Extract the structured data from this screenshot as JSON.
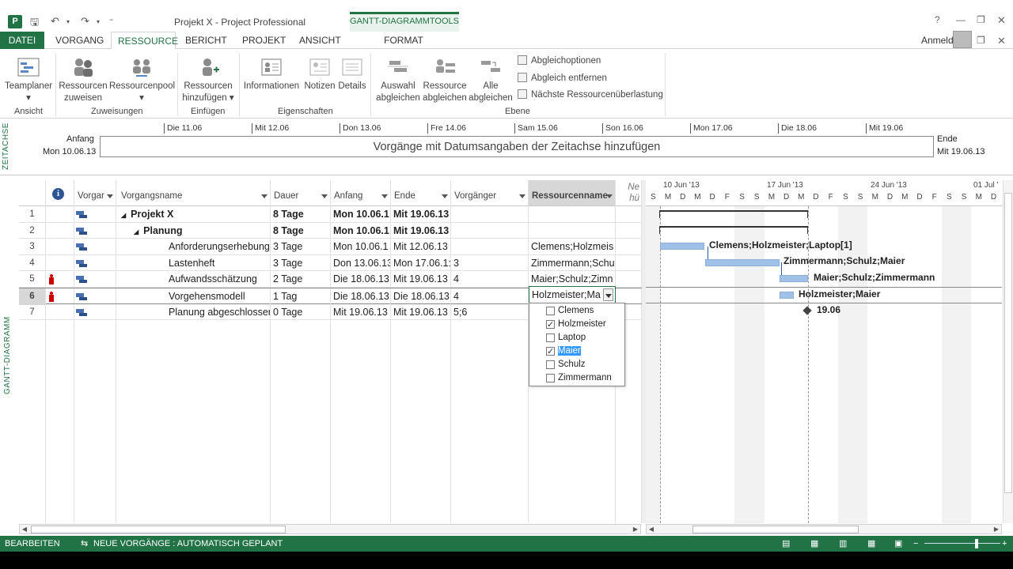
{
  "window": {
    "title": "Projekt X - Project Professional",
    "context_tab": "GANTT-DIAGRAMMTOOLS",
    "help": "?"
  },
  "tabs": [
    {
      "label": "DATEI"
    },
    {
      "label": "VORGANG"
    },
    {
      "label": "RESSOURCE"
    },
    {
      "label": "BERICHT"
    },
    {
      "label": "PROJEKT"
    },
    {
      "label": "ANSICHT"
    },
    {
      "label": "FORMAT"
    }
  ],
  "account": {
    "signin": "Anmelden"
  },
  "ribbon": {
    "buttons": {
      "teamplaner": [
        "Teamplaner",
        "▾"
      ],
      "ressourcen_zuweisen": [
        "Ressourcen",
        "zuweisen"
      ],
      "ressourcenpool": [
        "Ressourcenpool",
        "▾"
      ],
      "ressourcen_hinzufuegen": [
        "Ressourcen",
        "hinzufügen ▾"
      ],
      "informationen": "Informationen",
      "notizen": "Notizen",
      "details": "Details",
      "auswahl_abgleichen": [
        "Auswahl",
        "abgleichen"
      ],
      "ressource_abgleichen": [
        "Ressource",
        "abgleichen"
      ],
      "alle_abgleichen": [
        "Alle",
        "abgleichen"
      ],
      "abgleichoptionen": "Abgleichoptionen",
      "abgleich_entfernen": "Abgleich entfernen",
      "naechste_ueberlastung": "Nächste Ressourcenüberlastung"
    },
    "groups": {
      "ansicht": "Ansicht",
      "zuweisungen": "Zuweisungen",
      "einfuegen": "Einfügen",
      "eigenschaften": "Eigenschaften",
      "ebene": "Ebene"
    }
  },
  "timeline": {
    "side_label": "ZEITACHSE",
    "start_label": "Anfang",
    "start_date": "Mon 10.06.13",
    "end_label": "Ende",
    "end_date": "Mit 19.06.13",
    "placeholder": "Vorgänge mit Datumsangaben der Zeitachse hinzufügen",
    "days": [
      "Die 11.06",
      "Mit 12.06",
      "Don 13.06",
      "Fre 14.06",
      "Sam 15.06",
      "Son 16.06",
      "Mon 17.06",
      "Die 18.06",
      "Mit 19.06"
    ]
  },
  "view_label": "GANTT-DIAGRAMM",
  "grid": {
    "columns": {
      "info": "i",
      "mode": "Vorgar",
      "name": "Vorgangsname",
      "dauer": "Dauer",
      "anfang": "Anfang",
      "ende": "Ende",
      "vorgaenger": "Vorgänger",
      "ressourcen": "Ressourcenname",
      "neue_spalte": [
        "Ne",
        "hü"
      ]
    },
    "rows": [
      {
        "id": "1",
        "name": "Projekt X",
        "dauer": "8 Tage",
        "anfang": "Mon 10.06.1",
        "ende": "Mit 19.06.13",
        "vorgaenger": "",
        "ressourcen": "",
        "bold": true,
        "level": 0,
        "collapse": "◢",
        "person": false
      },
      {
        "id": "2",
        "name": "Planung",
        "dauer": "8 Tage",
        "anfang": "Mon 10.06.1",
        "ende": "Mit 19.06.13",
        "vorgaenger": "",
        "ressourcen": "",
        "bold": true,
        "level": 1,
        "collapse": "◢",
        "person": false
      },
      {
        "id": "3",
        "name": "Anforderungserhebung",
        "dauer": "3 Tage",
        "anfang": "Mon 10.06.1",
        "ende": "Mit 12.06.13",
        "vorgaenger": "",
        "ressourcen": "Clemens;Holzmeis",
        "bold": false,
        "level": 2,
        "collapse": "",
        "person": false
      },
      {
        "id": "4",
        "name": "Lastenheft",
        "dauer": "3 Tage",
        "anfang": "Don 13.06.13",
        "ende": "Mon 17.06.1:",
        "vorgaenger": "3",
        "ressourcen": "Zimmermann;Schu",
        "bold": false,
        "level": 2,
        "collapse": "",
        "person": false
      },
      {
        "id": "5",
        "name": "Aufwandsschätzung",
        "dauer": "2 Tage",
        "anfang": "Die 18.06.13",
        "ende": "Mit 19.06.13",
        "vorgaenger": "4",
        "ressourcen": "Maier;Schulz;Zimn",
        "bold": false,
        "level": 2,
        "collapse": "",
        "person": true
      },
      {
        "id": "6",
        "name": "Vorgehensmodell",
        "dauer": "1 Tag",
        "anfang": "Die 18.06.13",
        "ende": "Die 18.06.13",
        "vorgaenger": "4",
        "ressourcen": "",
        "bold": false,
        "level": 2,
        "collapse": "",
        "person": true
      },
      {
        "id": "7",
        "name": "Planung abgeschlossen",
        "dauer": "0 Tage",
        "anfang": "Mit 19.06.13",
        "ende": "Mit 19.06.13",
        "vorgaenger": "5;6",
        "ressourcen": "",
        "bold": false,
        "level": 2,
        "collapse": "",
        "person": false
      }
    ],
    "edit_value": "Holzmeister;Ma",
    "dropdown_options": [
      {
        "label": "Clemens",
        "checked": false,
        "highlighted": false
      },
      {
        "label": "Holzmeister",
        "checked": true,
        "highlighted": false
      },
      {
        "label": "Laptop",
        "checked": false,
        "highlighted": false
      },
      {
        "label": "Maier",
        "checked": true,
        "highlighted": true
      },
      {
        "label": "Schulz",
        "checked": false,
        "highlighted": false
      },
      {
        "label": "Zimmermann",
        "checked": false,
        "highlighted": false
      }
    ]
  },
  "gantt": {
    "weeks": [
      "10 Jun '13",
      "17 Jun '13",
      "24 Jun '13",
      "01 Jul '"
    ],
    "day_letters": [
      "S",
      "M",
      "D",
      "M",
      "D",
      "F",
      "S",
      "S",
      "M",
      "D",
      "M",
      "D",
      "F",
      "S",
      "S",
      "M",
      "D",
      "M",
      "D",
      "F",
      "S",
      "S",
      "M",
      "D"
    ],
    "bar_labels": [
      "Clemens;Holzmeister;Laptop[1]",
      "Zimmermann;Schulz;Maier",
      "Maier;Schulz;Zimmermann",
      "Holzmeister;Maier"
    ],
    "milestone_label": "19.06"
  },
  "status": {
    "mode": "BEARBEITEN",
    "new_tasks": "NEUE VORGÄNGE : AUTOMATISCH GEPLANT"
  },
  "colors": {
    "accent": "#217346",
    "bar": "#9fc1e8",
    "highlight": "#3399ff"
  }
}
